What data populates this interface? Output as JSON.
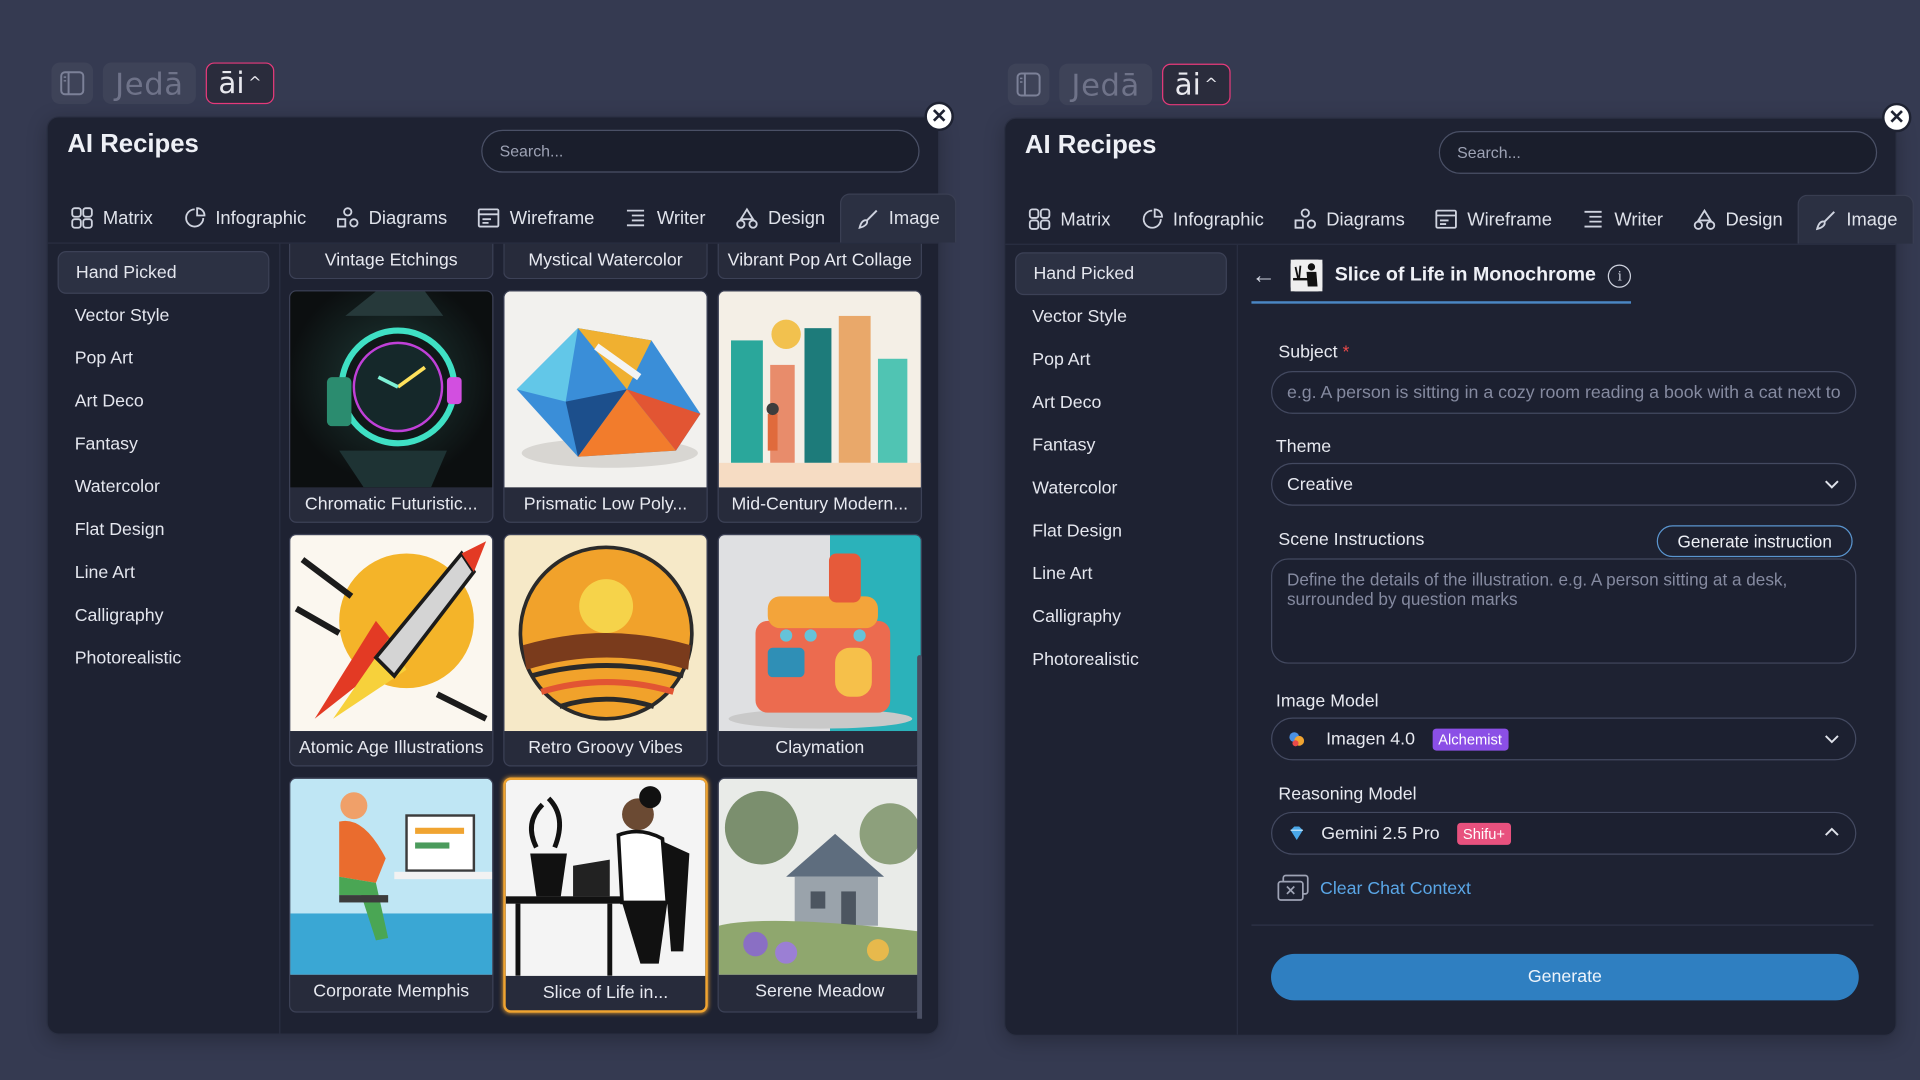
{
  "toolbar": {
    "logo": "Jedā",
    "ai": "āi",
    "ai_caret": "^"
  },
  "panel": {
    "title": "AI Recipes",
    "search_placeholder": "Search...",
    "tabs": [
      {
        "label": "Matrix",
        "icon": "grid-icon"
      },
      {
        "label": "Infographic",
        "icon": "pie-icon"
      },
      {
        "label": "Diagrams",
        "icon": "shapes-icon"
      },
      {
        "label": "Wireframe",
        "icon": "wireframe-icon"
      },
      {
        "label": "Writer",
        "icon": "list-icon"
      },
      {
        "label": "Design",
        "icon": "triangle-icon"
      },
      {
        "label": "Image",
        "icon": "brush-icon"
      }
    ],
    "sidebar": [
      "Hand Picked",
      "Vector Style",
      "Pop Art",
      "Art Deco",
      "Fantasy",
      "Watercolor",
      "Flat Design",
      "Line Art",
      "Calligraphy",
      "Photorealistic"
    ]
  },
  "gallery": {
    "top_row": [
      "Vintage Etchings",
      "Mystical Watercolor",
      "Vibrant Pop Art Collage"
    ],
    "cards": [
      "Chromatic Futuristic...",
      "Prismatic Low Poly...",
      "Mid-Century Modern...",
      "Atomic Age Illustrations",
      "Retro Groovy Vibes",
      "Claymation",
      "Corporate Memphis",
      "Slice of Life in...",
      "Serene Meadow"
    ]
  },
  "form": {
    "recipe_title": "Slice of Life in Monochrome",
    "back_arrow": "←",
    "info": "i",
    "subject_label": "Subject",
    "required": "*",
    "subject_placeholder": "e.g. A person is sitting in a cozy room reading a book with a cat next to th",
    "theme_label": "Theme",
    "theme_value": "Creative",
    "scene_label": "Scene Instructions",
    "generate_instruction": "Generate instruction",
    "scene_placeholder": "Define the details of the illustration. e.g. A person sitting at a desk, surrounded by question marks",
    "image_model_label": "Image Model",
    "image_model": "Imagen 4.0",
    "image_model_badge": "Alchemist",
    "reasoning_label": "Reasoning Model",
    "reasoning_model": "Gemini 2.5 Pro",
    "reasoning_badge": "Shifu+",
    "clear_chat": "Clear Chat Context",
    "generate": "Generate"
  },
  "colors": {
    "background": "#353a51",
    "panel": "#1e2232",
    "accent": "#2f7fc1",
    "highlight": "#f0a431",
    "ai_border": "#e73a7b"
  }
}
